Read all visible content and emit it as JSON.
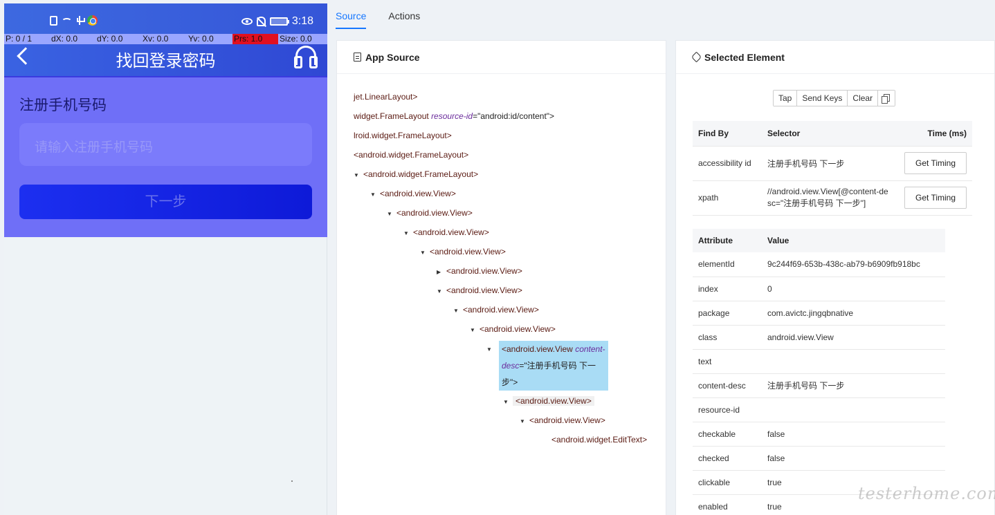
{
  "tabs": [
    {
      "label": "Source"
    },
    {
      "label": "Actions"
    }
  ],
  "phone": {
    "time": "3:18",
    "pointer": {
      "p": "P: 0 / 1",
      "dx": "dX: 0.0",
      "dy": "dY: 0.0",
      "xv": "Xv: 0.0",
      "yv": "Yv: 0.0",
      "prs": "Prs: 1.0",
      "size": "Size: 0.0"
    },
    "title": "找回登录密码",
    "label": "注册手机号码",
    "input_placeholder": "请输入注册手机号码",
    "next_button": "下一步",
    "colors": {
      "header": "#3a63e2",
      "body": "#6f6ff7",
      "button": "#1c2ff0",
      "pressure": "#e01020"
    }
  },
  "source": {
    "title": "App Source",
    "nodes": [
      {
        "text": "jet.LinearLayout>"
      },
      {
        "text": "widget.FrameLayout ",
        "attr": "resource-id",
        "val": "\"android:id/content\">"
      },
      {
        "text": "lroid.widget.FrameLayout>"
      },
      {
        "text": "<android.widget.FrameLayout>"
      },
      {
        "text": "<android.widget.FrameLayout>"
      },
      {
        "text": "<android.view.View>"
      },
      {
        "text": "<android.view.View>"
      },
      {
        "text": "<android.view.View>"
      },
      {
        "text": "<android.view.View>"
      },
      {
        "text": "<android.view.View>"
      },
      {
        "text": "<android.view.View>"
      },
      {
        "text": "<android.view.View>"
      },
      {
        "text": "<android.view.View>"
      },
      {
        "text": "<android.view.View ",
        "attr": "content-desc",
        "val": "=\"注册手机号码 下一步\">"
      },
      {
        "text": "<android.view.View>"
      },
      {
        "text": "<android.view.View>"
      },
      {
        "text": "<android.widget.EditText>"
      }
    ]
  },
  "element": {
    "title": "Selected Element",
    "actions": [
      "Tap",
      "Send Keys",
      "Clear"
    ],
    "findby_headers": {
      "find_by": "Find By",
      "selector": "Selector",
      "time": "Time (ms)"
    },
    "findby": [
      {
        "strategy": "accessibility id",
        "selector": "注册手机号码 下一步",
        "button": "Get Timing"
      },
      {
        "strategy": "xpath",
        "selector": "//android.view.View[@content-desc=\"注册手机号码 下一步\"]",
        "button": "Get Timing"
      }
    ],
    "attr_headers": {
      "attribute": "Attribute",
      "value": "Value"
    },
    "attributes": [
      {
        "name": "elementId",
        "value": "9c244f69-653b-438c-ab79-b6909fb918bc"
      },
      {
        "name": "index",
        "value": "0"
      },
      {
        "name": "package",
        "value": "com.avictc.jingqbnative"
      },
      {
        "name": "class",
        "value": "android.view.View"
      },
      {
        "name": "text",
        "value": ""
      },
      {
        "name": "content-desc",
        "value": "注册手机号码 下一步"
      },
      {
        "name": "resource-id",
        "value": ""
      },
      {
        "name": "checkable",
        "value": "false"
      },
      {
        "name": "checked",
        "value": "false"
      },
      {
        "name": "clickable",
        "value": "true"
      },
      {
        "name": "enabled",
        "value": "true"
      }
    ]
  },
  "watermark": "testerhome.com"
}
